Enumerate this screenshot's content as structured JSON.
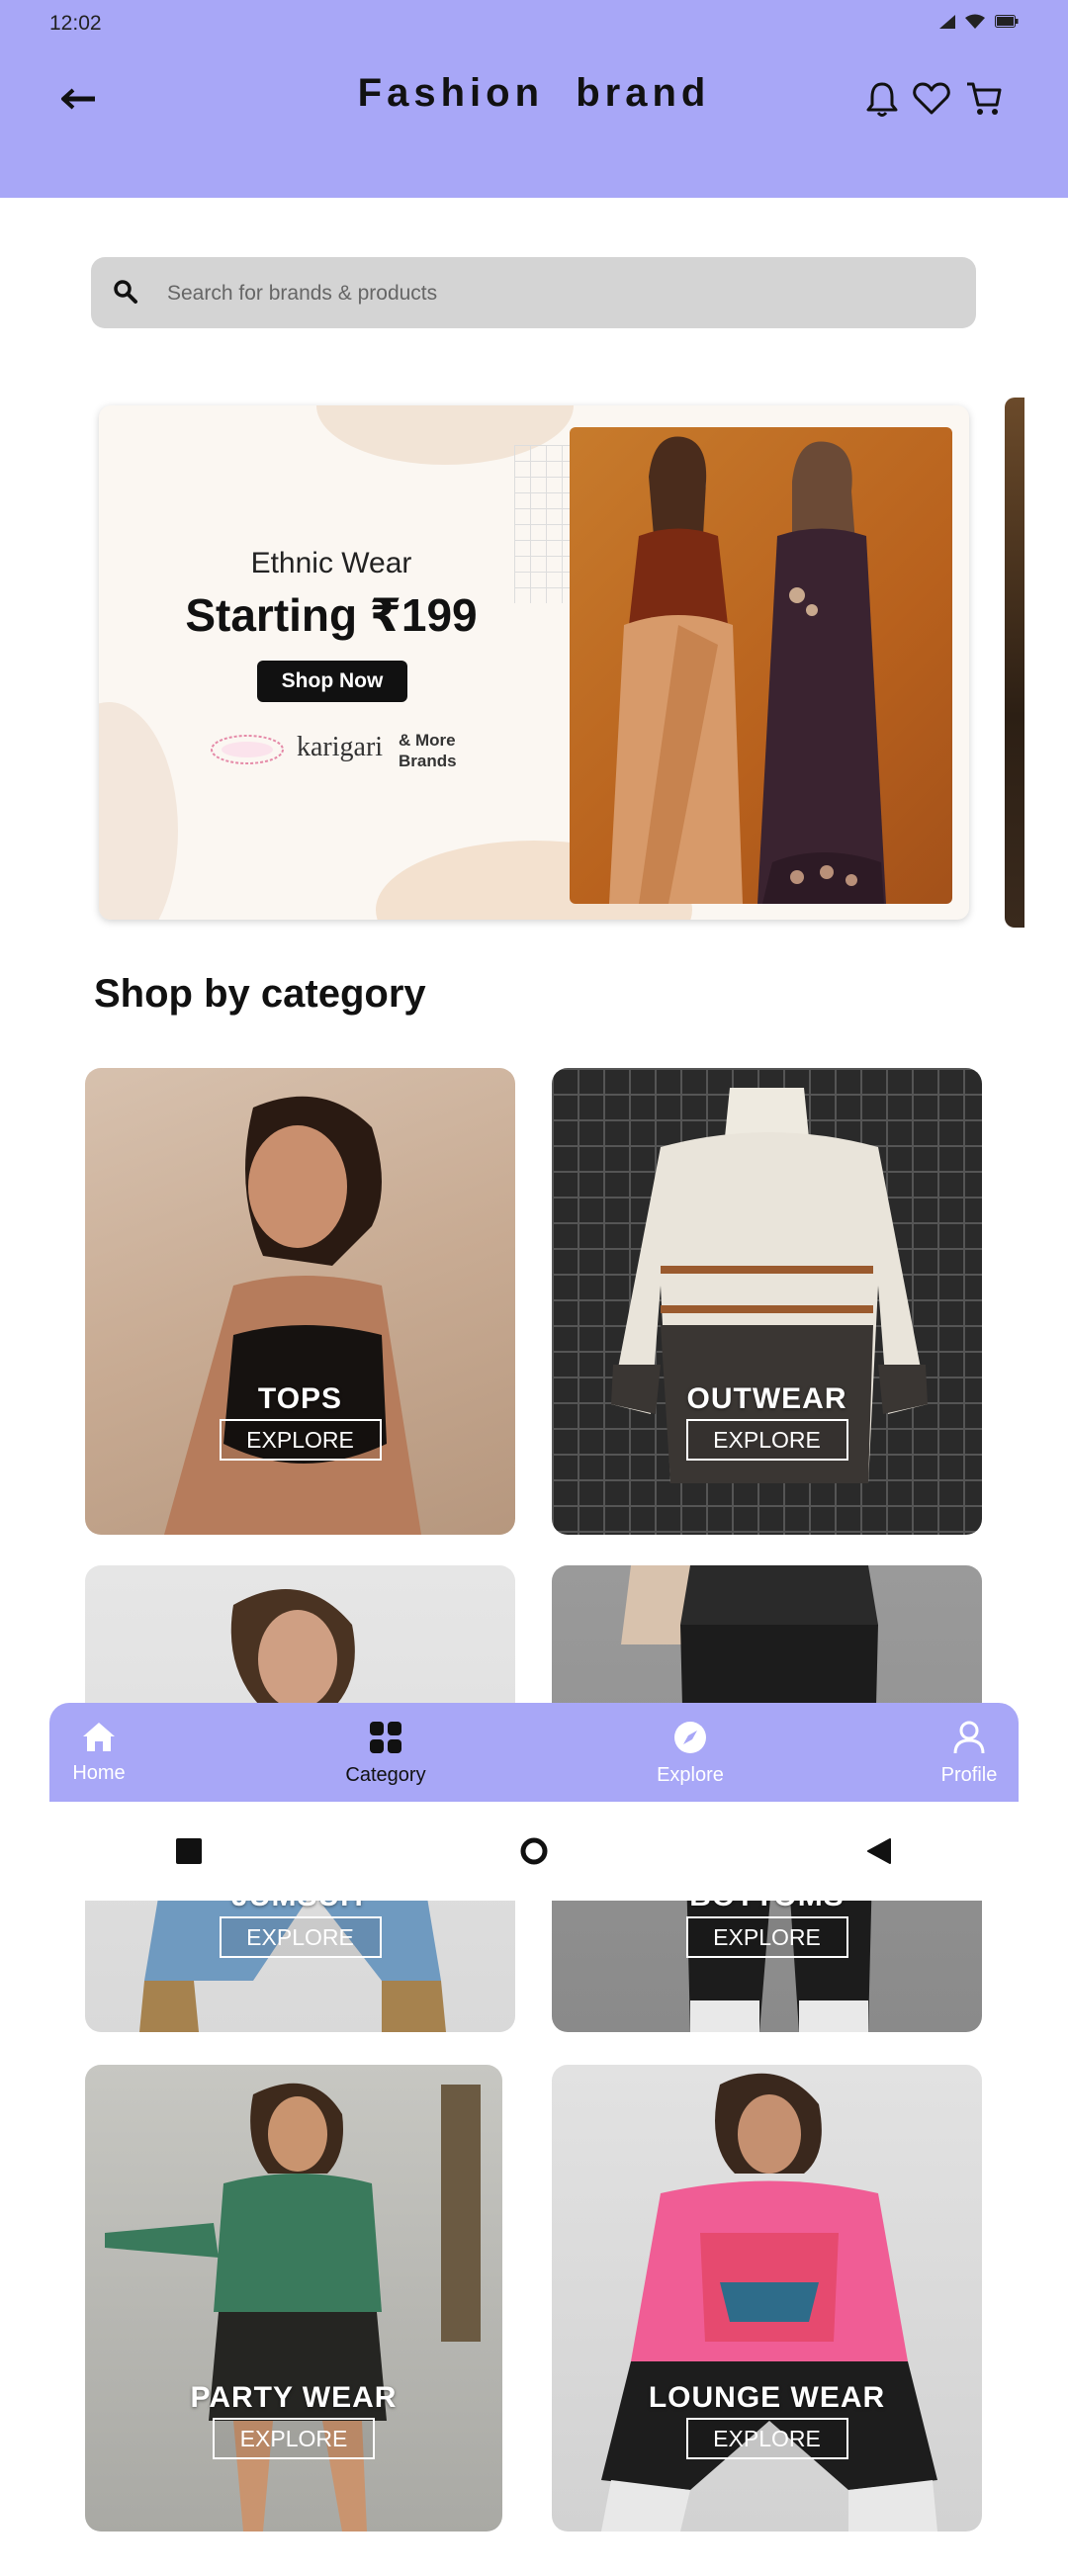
{
  "status": {
    "time": "12:02"
  },
  "header": {
    "title": "Fashion  brand"
  },
  "search": {
    "placeholder": "Search for brands & products"
  },
  "banner": {
    "subtitle": "Ethnic Wear",
    "headline": "Starting ₹199",
    "button": "Shop Now",
    "brand_logo": "karigari",
    "more_brands": "& More Brands"
  },
  "section_title": "Shop by category",
  "categories": [
    {
      "name": "TOPS",
      "action": "EXPLORE"
    },
    {
      "name": "OUTWEAR",
      "action": "EXPLORE"
    },
    {
      "name": "JUMSUIT",
      "action": "EXPLORE"
    },
    {
      "name": "BOTTOMS",
      "action": "EXPLORE"
    },
    {
      "name": "PARTY WEAR",
      "action": "EXPLORE"
    },
    {
      "name": "LOUNGE WEAR",
      "action": "EXPLORE"
    }
  ],
  "bottom_nav": [
    {
      "label": "Home",
      "icon": "home-icon"
    },
    {
      "label": "Category",
      "icon": "grid-icon"
    },
    {
      "label": "Explore",
      "icon": "compass-icon"
    },
    {
      "label": "Profile",
      "icon": "user-icon"
    }
  ],
  "colors": {
    "accent": "#a8a7f7"
  }
}
